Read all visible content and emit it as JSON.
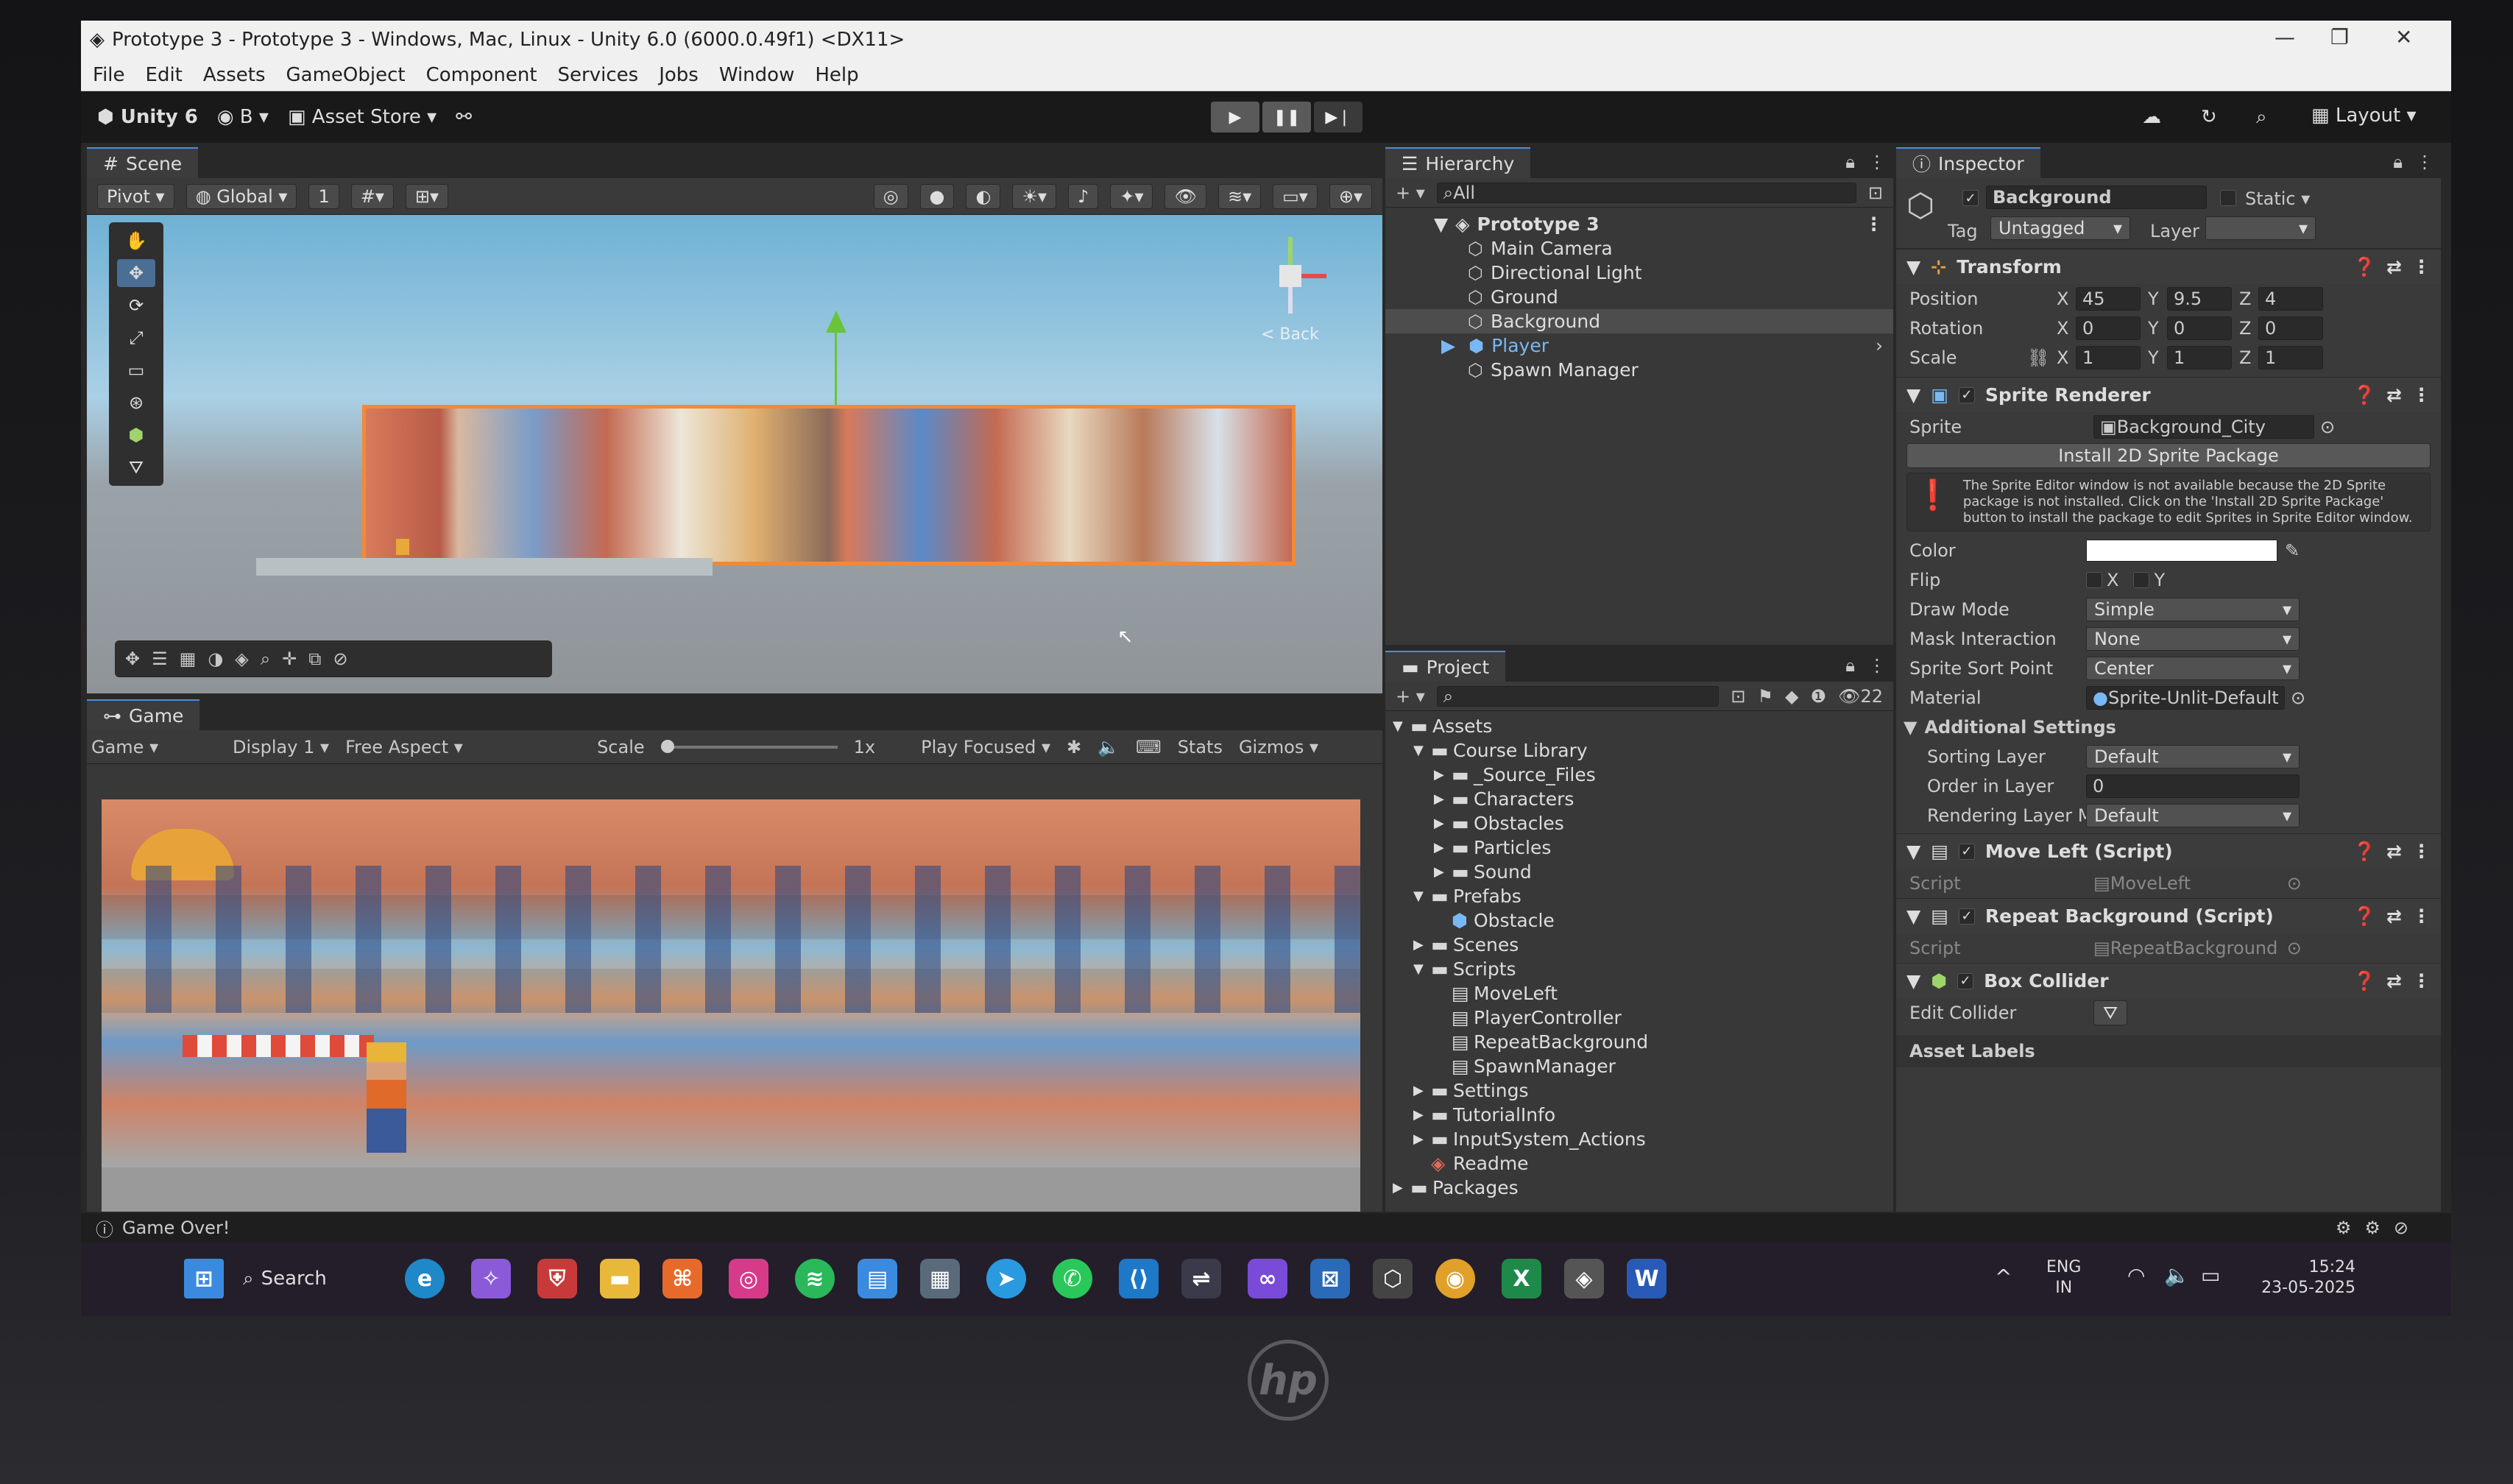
{
  "window": {
    "title": "Prototype 3 - Prototype 3 - Windows, Mac, Linux - Unity 6.0 (6000.0.49f1) <DX11>",
    "minimize": "—",
    "restore": "❐",
    "close": "✕"
  },
  "menu": [
    "File",
    "Edit",
    "Assets",
    "GameObject",
    "Component",
    "Services",
    "Jobs",
    "Window",
    "Help"
  ],
  "toolbar": {
    "unity_label": "Unity 6",
    "account": "B",
    "asset_store": "Asset Store",
    "layout": "Layout"
  },
  "scene": {
    "tab": "Scene",
    "pivot": "Pivot",
    "global": "Global",
    "grid_count": "1",
    "back_label": "< Back"
  },
  "game": {
    "tab": "Game",
    "mode": "Game",
    "display": "Display 1",
    "aspect": "Free Aspect",
    "scale_label": "Scale",
    "scale_value": "1x",
    "play_focused": "Play Focused",
    "stats": "Stats",
    "gizmos": "Gizmos"
  },
  "hierarchy": {
    "tab": "Hierarchy",
    "search_placeholder": "All",
    "scene_name": "Prototype 3",
    "items": [
      "Main Camera",
      "Directional Light",
      "Ground",
      "Background",
      "Player",
      "Spawn Manager"
    ]
  },
  "project": {
    "tab": "Project",
    "badge_count": "22",
    "tree": [
      {
        "label": "Assets",
        "depth": 0,
        "arrow": "▼",
        "kind": "folder"
      },
      {
        "label": "Course Library",
        "depth": 1,
        "arrow": "▼",
        "kind": "folder"
      },
      {
        "label": "_Source_Files",
        "depth": 2,
        "arrow": "▶",
        "kind": "folder"
      },
      {
        "label": "Characters",
        "depth": 2,
        "arrow": "▶",
        "kind": "folder"
      },
      {
        "label": "Obstacles",
        "depth": 2,
        "arrow": "▶",
        "kind": "folder"
      },
      {
        "label": "Particles",
        "depth": 2,
        "arrow": "▶",
        "kind": "folder"
      },
      {
        "label": "Sound",
        "depth": 2,
        "arrow": "▶",
        "kind": "folder"
      },
      {
        "label": "Prefabs",
        "depth": 1,
        "arrow": "▼",
        "kind": "folder"
      },
      {
        "label": "Obstacle",
        "depth": 2,
        "arrow": "",
        "kind": "prefab"
      },
      {
        "label": "Scenes",
        "depth": 1,
        "arrow": "▶",
        "kind": "folder"
      },
      {
        "label": "Scripts",
        "depth": 1,
        "arrow": "▼",
        "kind": "folder"
      },
      {
        "label": "MoveLeft",
        "depth": 2,
        "arrow": "",
        "kind": "script"
      },
      {
        "label": "PlayerController",
        "depth": 2,
        "arrow": "",
        "kind": "script"
      },
      {
        "label": "RepeatBackground",
        "depth": 2,
        "arrow": "",
        "kind": "script"
      },
      {
        "label": "SpawnManager",
        "depth": 2,
        "arrow": "",
        "kind": "script"
      },
      {
        "label": "Settings",
        "depth": 1,
        "arrow": "▶",
        "kind": "folder"
      },
      {
        "label": "TutorialInfo",
        "depth": 1,
        "arrow": "▶",
        "kind": "folder"
      },
      {
        "label": "InputSystem_Actions",
        "depth": 1,
        "arrow": "▶",
        "kind": "folder"
      },
      {
        "label": "Readme",
        "depth": 1,
        "arrow": "",
        "kind": "readme"
      },
      {
        "label": "Packages",
        "depth": 0,
        "arrow": "▶",
        "kind": "folder"
      }
    ]
  },
  "inspector": {
    "tab": "Inspector",
    "object_name": "Background",
    "static_label": "Static",
    "tag_label": "Tag",
    "tag_value": "Untagged",
    "layer_label": "Layer",
    "transform": {
      "title": "Transform",
      "position_label": "Position",
      "rotation_label": "Rotation",
      "scale_label": "Scale",
      "px": "45",
      "py": "9.5",
      "pz": "4",
      "rx": "0",
      "ry": "0",
      "rz": "0",
      "sx": "1",
      "sy": "1",
      "sz": "1"
    },
    "sprite_renderer": {
      "title": "Sprite Renderer",
      "sprite_label": "Sprite",
      "sprite_value": "Background_City",
      "install_button": "Install 2D Sprite Package",
      "help_text": "The Sprite Editor window is not available because the 2D Sprite package is not installed. Click on the 'Install 2D Sprite Package' button to install the package to edit Sprites in Sprite Editor window.",
      "color_label": "Color",
      "flip_label": "Flip",
      "flip_x": "X",
      "flip_y": "Y",
      "draw_mode_label": "Draw Mode",
      "draw_mode_value": "Simple",
      "mask_label": "Mask Interaction",
      "mask_value": "None",
      "sort_point_label": "Sprite Sort Point",
      "sort_point_value": "Center",
      "material_label": "Material",
      "material_value": "Sprite-Unlit-Default",
      "additional_label": "Additional Settings",
      "sorting_layer_label": "Sorting Layer",
      "sorting_layer_value": "Default",
      "order_label": "Order in Layer",
      "order_value": "0",
      "rendering_label": "Rendering Layer M",
      "rendering_value": "Default"
    },
    "move_left": {
      "title": "Move Left (Script)",
      "script_label": "Script",
      "script_value": "MoveLeft"
    },
    "repeat_bg": {
      "title": "Repeat Background (Script)",
      "script_label": "Script",
      "script_value": "RepeatBackground"
    },
    "box_collider": {
      "title": "Box Collider",
      "edit_label": "Edit Collider"
    },
    "asset_labels": "Asset Labels"
  },
  "status": {
    "message": "Game Over!"
  },
  "taskbar": {
    "search": "Search",
    "lang1": "ENG",
    "lang2": "IN",
    "time": "15:24",
    "date": "23-05-2025"
  },
  "brand": "hp",
  "colors": {
    "accent": "#4a8fd8",
    "selection": "#2c5d87",
    "orange_outline": "#f08a3a"
  }
}
